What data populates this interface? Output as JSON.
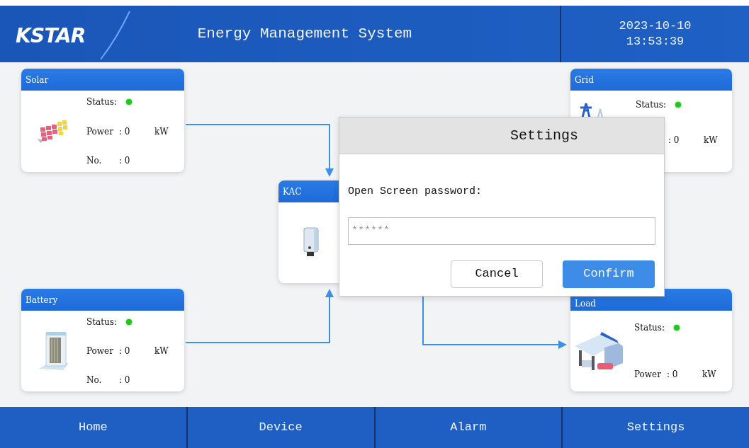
{
  "header": {
    "logo": "KSTAR",
    "title": "Energy Management System",
    "date": "2023-10-10",
    "time": "13:53:39"
  },
  "cards": [
    {
      "kind": "solar",
      "title": "Solar",
      "rows": [
        {
          "kind": "status",
          "label": "Status:",
          "on": true
        },
        {
          "kind": "value",
          "label": "Power",
          "value": ": 0",
          "unit": "kW"
        },
        {
          "kind": "value",
          "label": "No.",
          "value": ": 0"
        }
      ]
    },
    {
      "kind": "grid",
      "title": "Grid",
      "rows": [
        {
          "kind": "status",
          "label": "Status:",
          "on": true
        },
        {
          "kind": "value",
          "value": ": 0",
          "unit": "kW"
        }
      ]
    },
    {
      "kind": "inverter",
      "title": "KAC"
    },
    {
      "kind": "battery",
      "title": "Battery",
      "rows": [
        {
          "kind": "status",
          "label": "Status:",
          "on": true
        },
        {
          "kind": "value",
          "label": "Power",
          "value": ": 0",
          "unit": "kW"
        },
        {
          "kind": "value",
          "label": "No.",
          "value": ": 0"
        }
      ]
    },
    {
      "kind": "load",
      "title": "Load",
      "rows": [
        {
          "kind": "status",
          "label": "Status:",
          "on": true
        },
        {
          "kind": "value",
          "label": "Power",
          "value": ": 0",
          "unit": "kW"
        }
      ]
    }
  ],
  "dialog": {
    "title": "Settings",
    "label": "Open Screen password:",
    "placeholder": "******",
    "buttons": [
      {
        "label": "Cancel",
        "kind": "secondary"
      },
      {
        "label": "Confirm",
        "kind": "primary"
      }
    ]
  },
  "tabs": [
    {
      "label": "Home",
      "selected": false
    },
    {
      "label": "Device",
      "selected": false
    },
    {
      "label": "Alarm",
      "selected": false
    },
    {
      "label": "Settings",
      "selected": false
    }
  ]
}
